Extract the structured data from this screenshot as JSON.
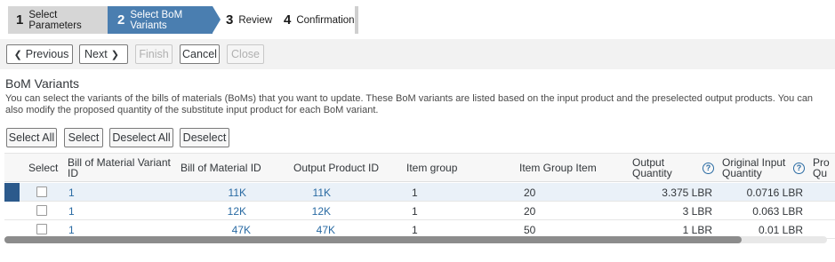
{
  "wizard": {
    "steps": [
      {
        "num": "1",
        "label": "Select Parameters"
      },
      {
        "num": "2",
        "label": "Select BoM Variants"
      },
      {
        "num": "3",
        "label": "Review"
      },
      {
        "num": "4",
        "label": "Confirmation"
      }
    ],
    "active_step": 2
  },
  "nav": {
    "previous": "Previous",
    "next": "Next",
    "finish": "Finish",
    "cancel": "Cancel",
    "close": "Close"
  },
  "section": {
    "title": "BoM Variants",
    "description": "You can select the variants of the bills of materials (BoMs) that you want to update. These BoM variants are listed based on the input product and the preselected output products. You can also modify the proposed quantity of the substitute input product for each BoM variant."
  },
  "table_toolbar": {
    "select_all": "Select All",
    "select": "Select",
    "deselect_all": "Deselect All",
    "deselect": "Deselect"
  },
  "table": {
    "columns": {
      "select": "Select",
      "variant_id": "Bill of Material Variant ID",
      "bom_id": "Bill of Material ID",
      "output_product_id": "Output Product ID",
      "item_group": "Item group",
      "item_group_item": "Item Group Item",
      "output_quantity": "Output Quantity",
      "original_input_quantity": "Original Input Quantity",
      "truncated": "Pro Qu"
    },
    "rows": [
      {
        "variant_id": "1",
        "bom_id": "11K",
        "output_product_id": "11K",
        "item_group": "1",
        "item_group_item": "20",
        "output_quantity": "3.375 LBR",
        "original_input_quantity": "0.0716 LBR",
        "selected": true
      },
      {
        "variant_id": "1",
        "bom_id": "12K",
        "output_product_id": "12K",
        "item_group": "1",
        "item_group_item": "20",
        "output_quantity": "3 LBR",
        "original_input_quantity": "0.063 LBR",
        "selected": false
      },
      {
        "variant_id": "1",
        "bom_id": "47K",
        "output_product_id": "47K",
        "item_group": "1",
        "item_group_item": "50",
        "output_quantity": "1 LBR",
        "original_input_quantity": "0.01 LBR",
        "selected": false
      }
    ]
  },
  "colors": {
    "active_step": "#4a7eb0",
    "link": "#2a6ba3",
    "selected_row_marker": "#2c5a8c"
  },
  "icons": {
    "help": "help-icon",
    "prev": "chevron-left-icon",
    "next": "chevron-right-icon"
  }
}
